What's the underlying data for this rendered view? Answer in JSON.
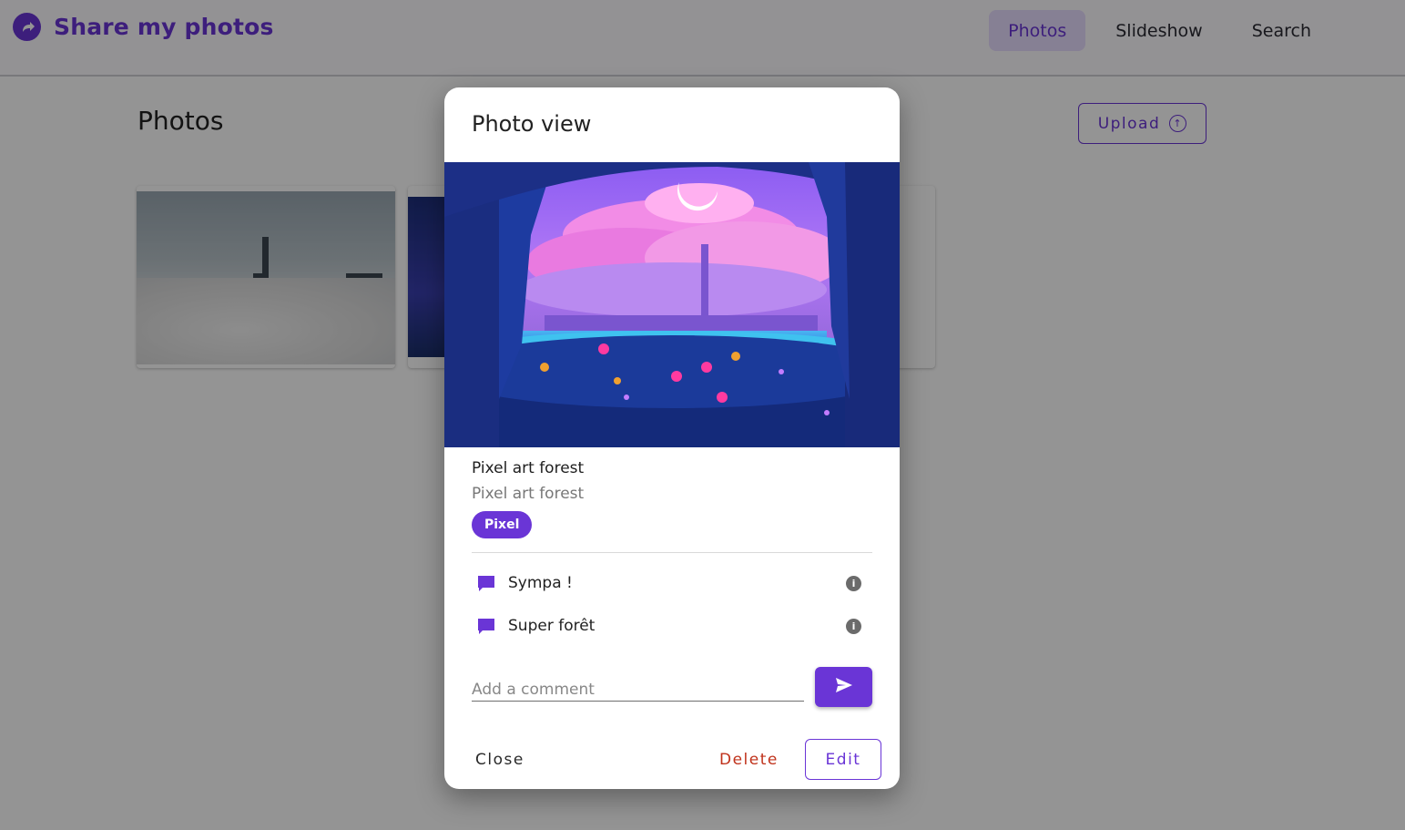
{
  "app": {
    "title": "Share my photos"
  },
  "nav": {
    "items": [
      {
        "label": "Photos",
        "active": true
      },
      {
        "label": "Slideshow"
      },
      {
        "label": "Search"
      }
    ]
  },
  "page": {
    "title": "Photos",
    "upload_label": "Upload"
  },
  "dialog": {
    "title": "Photo view",
    "photo": {
      "title": "Pixel art forest",
      "description": "Pixel art forest",
      "tag": "Pixel"
    },
    "comments": [
      {
        "text": "Sympa !"
      },
      {
        "text": "Super forêt"
      }
    ],
    "comment_input": {
      "placeholder": "Add a comment",
      "value": ""
    },
    "actions": {
      "close": "Close",
      "delete": "Delete",
      "edit": "Edit"
    }
  },
  "colors": {
    "accent": "#6a35d6",
    "danger": "#c0321b",
    "active_nav_bg": "#e7dcff"
  }
}
